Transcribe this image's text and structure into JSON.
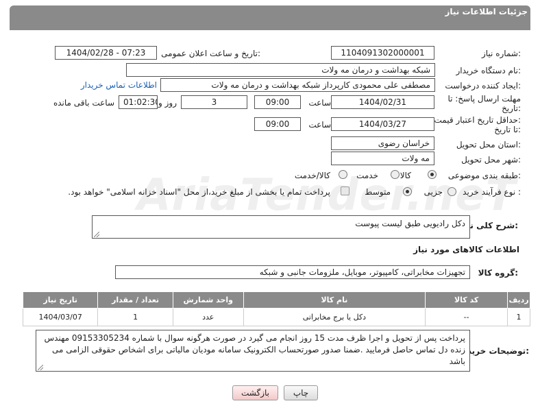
{
  "header": {
    "title": "جزئیات اطلاعات نیاز"
  },
  "fields": {
    "need_number_label": "شماره نیاز:",
    "need_number": "1104091302000001",
    "announce_label": "تاریخ و ساعت اعلان عمومی:",
    "announce_value": "1404/02/28 - 07:23",
    "buyer_org_label": "نام دستگاه خریدار:",
    "buyer_org": "شبکه بهداشت و درمان مه ولات",
    "creator_label": "ایجاد کننده درخواست:",
    "creator": "مصطفی علی محمودی کارپرداز شبکه بهداشت و درمان مه ولات",
    "contact_link": "اطلاعات تماس خریدار",
    "deadline_label_1": "مهلت ارسال پاسخ: تا",
    "deadline_label_2": "تاریخ:",
    "deadline_date": "1404/02/31",
    "time_label": "ساعت",
    "deadline_time": "09:00",
    "days_value": "3",
    "days_label": "روز و",
    "remaining_time": "01:02:30",
    "remaining_label": "ساعت باقی مانده",
    "price_label_1": "حداقل تاریخ اعتبار قیمت:",
    "price_label_2": "تا تاریخ:",
    "price_date": "1404/03/27",
    "price_time": "09:00",
    "province_label": "استان محل تحویل:",
    "province": "خراسان رضوی",
    "city_label": "شهر محل تحویل:",
    "city": "مه ولات",
    "category_label": "طبقه بندی موضوعی:",
    "category_options": [
      "کالا",
      "خدمت",
      "کالا/خدمت"
    ],
    "process_label": "نوع فرآیند خرید :",
    "process_options": [
      "جزیی",
      "متوسط"
    ],
    "payment_note": "پرداخت تمام یا بخشی از مبلغ خرید،از محل \"اسناد خزانه اسلامی\" خواهد بود."
  },
  "description": {
    "label": "شرح کلی نیاز:",
    "value": "دکل رادیویی طبق لیست پیوست"
  },
  "goods": {
    "section_title": "اطلاعات کالاهای مورد نیاز",
    "group_label": "گروه کالا:",
    "group_value": "تجهیزات مخابراتی، کامپیوتر، موبایل، ملزومات جانبی و شبکه",
    "columns": [
      "ردیف",
      "کد کالا",
      "نام کالا",
      "واحد شمارش",
      "تعداد / مقدار",
      "تاریخ نیاز"
    ],
    "rows": [
      {
        "row": "1",
        "code": "--",
        "name": "دکل یا برج مخابراتی",
        "unit": "عدد",
        "qty": "1",
        "date": "1404/03/07"
      }
    ]
  },
  "buyer_notes": {
    "label": "توضیحات خریدار:",
    "value": "پرداخت پس از تحویل و اجرا ظرف مدت 15 روز انجام می گیرد در صورت هرگونه سوال با شماره 09153305234 مهندس زنده دل تماس حاصل فرمایید .ضمنا صدور صورتحساب الکترونیک سامانه مودیان مالیاتی برای اشخاص حقوقی الزامی می باشد"
  },
  "buttons": {
    "print": "چاپ",
    "back": "بازگشت"
  },
  "watermark": "AriaTender.neT"
}
